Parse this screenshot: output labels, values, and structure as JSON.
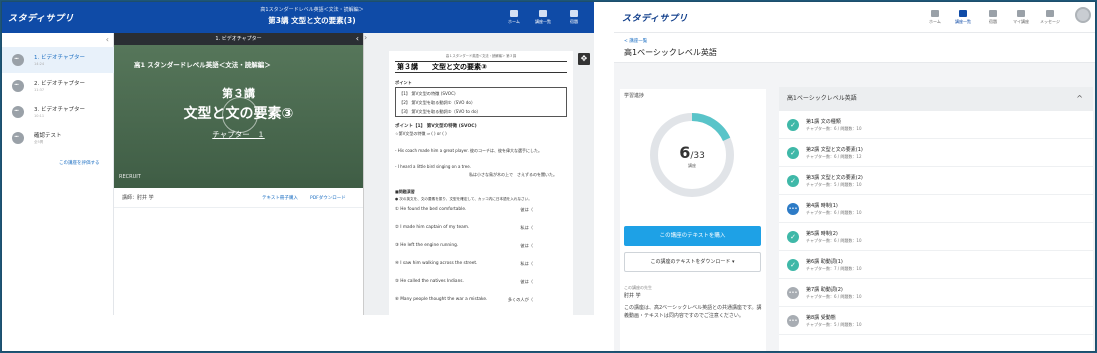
{
  "left_app": {
    "logo": "スタディサプリ",
    "header": {
      "subtitle": "高1スタンダードレベル英語＜文法・読解編＞",
      "title": "第3講 文型と文の要素(3)"
    },
    "nav_icons": [
      {
        "label": "ホーム",
        "icon": "home-icon"
      },
      {
        "label": "講座一覧",
        "icon": "book-list-icon"
      },
      {
        "label": "宿題",
        "icon": "homework-icon"
      }
    ],
    "sidebar": {
      "items": [
        {
          "title": "1. ビデオチャプター",
          "meta": "14:24"
        },
        {
          "title": "2. ビデオチャプター",
          "meta": "11:37"
        },
        {
          "title": "3. ビデオチャプター",
          "meta": "10:11"
        },
        {
          "title": "確認テスト",
          "meta": "全5問"
        }
      ],
      "eval_link": "この講座を評価する"
    },
    "video": {
      "bar_title": "1. ビデオチャプター",
      "course": "高1 スタンダードレベル英語＜文法・読解編＞",
      "lecture_no": "第３講",
      "lecture_title": "文型と文の要素③",
      "chapter": "チャプター　１",
      "brand": "RECRUIT"
    },
    "lecturer": "講師：肘井 学",
    "buy_text": "テキスト冊子購入",
    "pdf_download": "PDFダウンロード",
    "textbook": {
      "page_top": "高１スタンダード英語＜文法・読解編＞  第３講",
      "heading": "第３講　　文型と文の要素③",
      "point_label": "ポイント",
      "points": [
        "【1】  第V文型の特徴 (SVOC)",
        "【2】  第V文型を取る動詞①（SVO do）",
        "【3】  第V文型を取る動詞②（SVO to do）"
      ],
      "point1_title": "ポイント【1】 第V文型の特徴 (SVOC)",
      "point1_note": "☆第V文型の特徴 ⇒ (                         )  or  (                         )",
      "ex1": "- His coach made him a great player. 彼のコーチは、彼を偉大な選手にした。",
      "ex2": "- I heard a little bird singing on a tree.",
      "ex2_jp": "私は小さな鳥が木の上で　さえずるのを聞いた。",
      "exercise_label": "■問題演習",
      "exercise_instr": "● 次の英文を、文の要素を振り、文型を確定して、カッコ内に日本語を入れなさい。",
      "questions": [
        {
          "en": "① He found the bed comfortable.",
          "jp": "彼は（"
        },
        {
          "en": "② I made him captain of my team.",
          "jp": "私は（"
        },
        {
          "en": "③ He left the engine running.",
          "jp": "彼は（"
        },
        {
          "en": "④ I saw him walking across the street.",
          "jp": "私は（"
        },
        {
          "en": "⑤ He called the natives Indians.",
          "jp": "彼は（"
        },
        {
          "en": "⑥ Many people thought the war a mistake.",
          "jp": "多くの人が（"
        }
      ]
    }
  },
  "right_app": {
    "logo": "スタディサプリ",
    "nav_icons": [
      {
        "label": "ホーム",
        "icon": "home-icon"
      },
      {
        "label": "講座一覧",
        "icon": "book-list-icon"
      },
      {
        "label": "宿題",
        "icon": "homework-icon"
      },
      {
        "label": "マイ講座",
        "icon": "my-course-icon"
      },
      {
        "label": "メッセージ",
        "icon": "message-icon"
      }
    ],
    "back_link": "< 講座一覧",
    "course_title": "高1ベーシックレベル英語",
    "progress": {
      "label": "学習進捗",
      "done": "6",
      "total": "/33",
      "unit": "講座",
      "fraction": 0.1818
    },
    "buy_button": "この講座のテキストを購入",
    "download_button": "この講座のテキストをダウンロード  ▾",
    "teacher_label": "この講座の先生",
    "teacher_name": "肘井 学",
    "description": "この講座は、高2ベーシックレベル英語との共通講座です。講義動画・テキストは同内容ですのでご注意ください。",
    "list_header": "高1ベーシックレベル英語",
    "lessons": [
      {
        "title": "第1講 文の種類",
        "meta": "チャプター数：6 / 問題数：10",
        "status": "done"
      },
      {
        "title": "第2講 文型と文の要素(1)",
        "meta": "チャプター数：6 / 問題数：12",
        "status": "done"
      },
      {
        "title": "第3講 文型と文の要素(2)",
        "meta": "チャプター数：5 / 問題数：10",
        "status": "done"
      },
      {
        "title": "第4講 時制(1)",
        "meta": "チャプター数：6 / 問題数：10",
        "status": "in-progress"
      },
      {
        "title": "第5講 時制(2)",
        "meta": "チャプター数：6 / 問題数：10",
        "status": "done"
      },
      {
        "title": "第6講 助動詞(1)",
        "meta": "チャプター数：7 / 問題数：10",
        "status": "done"
      },
      {
        "title": "第7講 助動詞(2)",
        "meta": "チャプター数：6 / 問題数：10",
        "status": "none"
      },
      {
        "title": "第8講 受動態",
        "meta": "チャプター数：5 / 問題数：10",
        "status": "none"
      }
    ]
  }
}
